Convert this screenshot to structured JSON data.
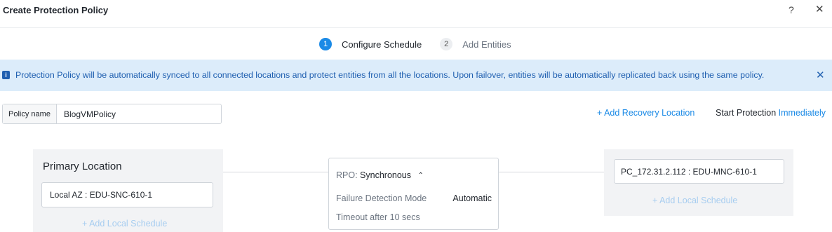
{
  "dialog": {
    "title": "Create Protection Policy",
    "help_label": "?",
    "close_label": "✕"
  },
  "steps": [
    {
      "number": "1",
      "label": "Configure Schedule",
      "active": true
    },
    {
      "number": "2",
      "label": "Add Entities",
      "active": false
    }
  ],
  "banner": {
    "icon": "info-icon",
    "text": "Protection Policy will be automatically synced to all connected locations and protect entities from all the locations. Upon failover, entities will be automatically replicated back using the same policy.",
    "close_label": "✕"
  },
  "policy": {
    "label": "Policy name",
    "value": "BlogVMPolicy"
  },
  "actions": {
    "add_recovery_location": "+ Add Recovery Location",
    "start_protection_label": "Start Protection",
    "start_protection_value": "Immediately"
  },
  "primary": {
    "title": "Primary Location",
    "location": "Local AZ : EDU-SNC-610-1",
    "add_schedule": "+ Add Local Schedule"
  },
  "rpo": {
    "label": "RPO:",
    "value": "Synchronous",
    "chevron": "⌃",
    "failure_detection_label": "Failure Detection Mode",
    "failure_detection_value": "Automatic",
    "timeout": "Timeout after 10 secs"
  },
  "recovery": {
    "location": "PC_172.31.2.112 : EDU-MNC-610-1",
    "add_schedule": "+ Add Local Schedule"
  },
  "colors": {
    "accent": "#1b8ae6",
    "banner_bg": "#dcecfa",
    "banner_text": "#1f5fb0",
    "panel_bg": "#f2f3f5"
  }
}
